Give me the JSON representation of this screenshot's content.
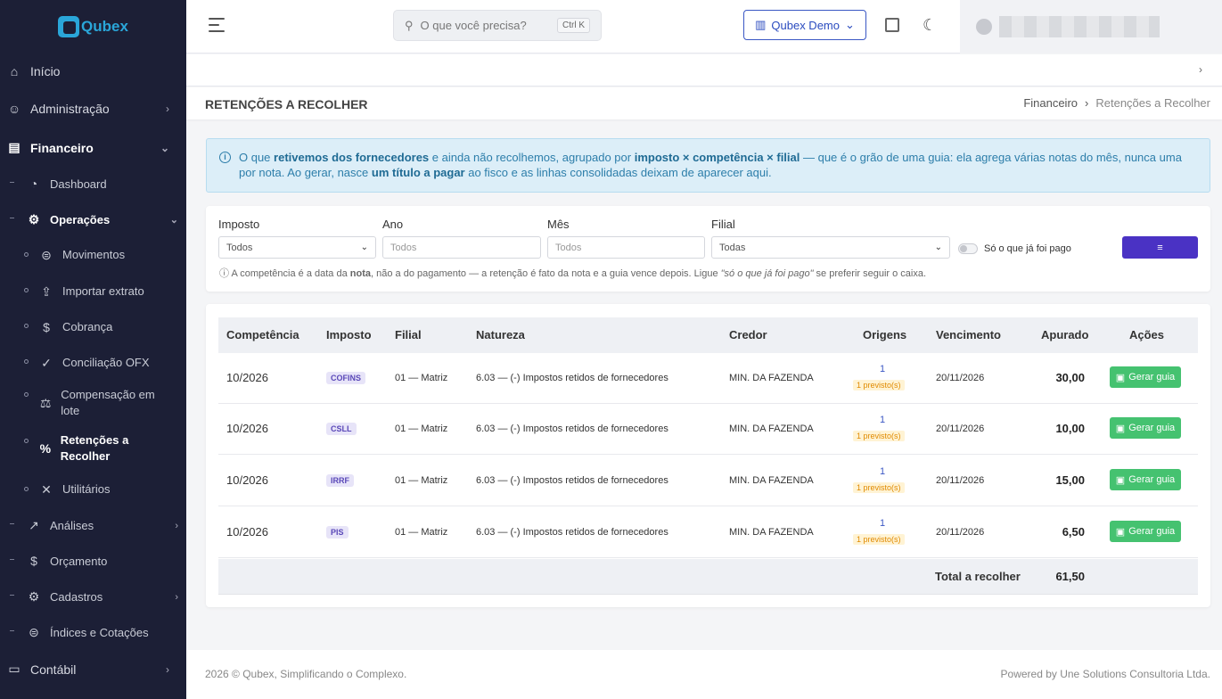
{
  "brand": {
    "name": "Qubex",
    "color": "#2aa6d9"
  },
  "sidebar": {
    "inicio": "Início",
    "administracao": "Administração",
    "financeiro": "Financeiro",
    "dashboard": "Dashboard",
    "operacoes": "Operações",
    "movimentos": "Movimentos",
    "importar": "Importar extrato",
    "cobranca": "Cobrança",
    "conciliacao": "Conciliação OFX",
    "compensacao": "Compensação em lote",
    "retencoes": "Retenções a Recolher",
    "utilitarios": "Utilitários",
    "analises": "Análises",
    "orcamento": "Orçamento",
    "cadastros": "Cadastros",
    "indices": "Índices e Cotações",
    "contabil": "Contábil"
  },
  "topbar": {
    "search_placeholder": "O que você precisa?",
    "shortcut": "Ctrl K",
    "company": "Qubex Demo"
  },
  "page": {
    "title": "RETENÇÕES A RECOLHER",
    "crumb_parent": "Financeiro",
    "crumb_current": "Retenções a Recolher"
  },
  "info": {
    "t1": "O que ",
    "b1": "retivemos dos fornecedores",
    "t2": " e ainda não recolhemos, agrupado por ",
    "b2": "imposto × competência × filial",
    "t3": " — que é o grão de uma guia: ela agrega várias notas do mês, nunca uma por nota. Ao gerar, nasce ",
    "b3": "um título a pagar",
    "t4": " ao fisco e as linhas consolidadas deixam de aparecer aqui."
  },
  "filters": {
    "imposto_label": "Imposto",
    "imposto_value": "Todos",
    "ano_label": "Ano",
    "ano_placeholder": "Todos",
    "mes_label": "Mês",
    "mes_placeholder": "Todos",
    "filial_label": "Filial",
    "filial_value": "Todas",
    "toggle_label": "Só o que já foi pago",
    "hint_a": "A competência é a data da ",
    "hint_b": "nota",
    "hint_c": ", não a do pagamento — a retenção é fato da nota e a guia vence depois. Ligue ",
    "hint_d": "\"só o que já foi pago\"",
    "hint_e": " se preferir seguir o caixa."
  },
  "table": {
    "headers": [
      "Competência",
      "Imposto",
      "Filial",
      "Natureza",
      "Credor",
      "Origens",
      "Vencimento",
      "Apurado",
      "Ações"
    ],
    "rows": [
      {
        "competencia": "10/2026",
        "imposto": "COFINS",
        "filial": "01 — Matriz",
        "natureza": "6.03 — (-) Impostos retidos de fornecedores",
        "credor": "MIN. DA FAZENDA",
        "origens": "1",
        "previsto": "1 previsto(s)",
        "vencimento": "20/11/2026",
        "apurado": "30,00",
        "acao": "Gerar guia"
      },
      {
        "competencia": "10/2026",
        "imposto": "CSLL",
        "filial": "01 — Matriz",
        "natureza": "6.03 — (-) Impostos retidos de fornecedores",
        "credor": "MIN. DA FAZENDA",
        "origens": "1",
        "previsto": "1 previsto(s)",
        "vencimento": "20/11/2026",
        "apurado": "10,00",
        "acao": "Gerar guia"
      },
      {
        "competencia": "10/2026",
        "imposto": "IRRF",
        "filial": "01 — Matriz",
        "natureza": "6.03 — (-) Impostos retidos de fornecedores",
        "credor": "MIN. DA FAZENDA",
        "origens": "1",
        "previsto": "1 previsto(s)",
        "vencimento": "20/11/2026",
        "apurado": "15,00",
        "acao": "Gerar guia"
      },
      {
        "competencia": "10/2026",
        "imposto": "PIS",
        "filial": "01 — Matriz",
        "natureza": "6.03 — (-) Impostos retidos de fornecedores",
        "credor": "MIN. DA FAZENDA",
        "origens": "1",
        "previsto": "1 previsto(s)",
        "vencimento": "20/11/2026",
        "apurado": "6,50",
        "acao": "Gerar guia"
      }
    ],
    "total_label": "Total a recolher",
    "total_value": "61,50"
  },
  "footer": {
    "left": "2026 © Qubex, Simplificando o Complexo.",
    "right": "Powered by Une Solutions Consultoria Ltda."
  },
  "icons": [
    "menu-icon",
    "search-icon",
    "building-icon",
    "fullscreen-icon",
    "moon-icon",
    "home-icon",
    "user-icon",
    "wallet-icon",
    "gauge-icon",
    "operations-icon",
    "coin-icon",
    "upload-icon",
    "dollar-icon",
    "check-icon",
    "scale-icon",
    "percent-icon",
    "tools-icon",
    "chart-icon",
    "calculator-icon",
    "gear-icon",
    "book-icon",
    "info-icon",
    "filter-icon",
    "document-icon"
  ]
}
